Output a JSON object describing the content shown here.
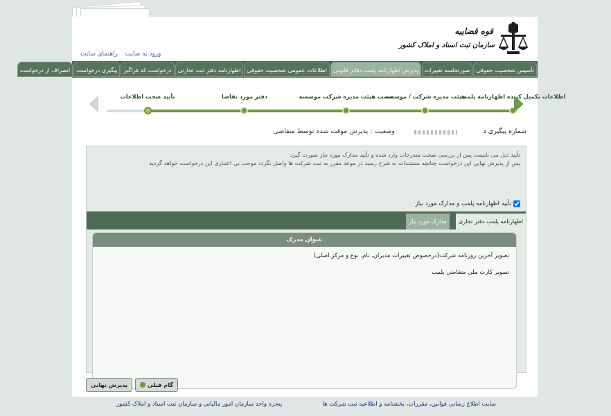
{
  "header": {
    "logo_title": "قوه قضاییه",
    "logo_subtitle": "سازمان ثبت اسناد و املاک کشور",
    "links": [
      "ورود به سایت",
      "راهنمای سایت"
    ]
  },
  "nav": {
    "tabs": [
      {
        "label": "تأسیس شخصیت حقوقی",
        "active": false
      },
      {
        "label": "صورتجلسه تغییرات",
        "active": false
      },
      {
        "label": "پذیرش اظهارنامه پلمب دفاتر قانونی",
        "active": true
      },
      {
        "label": "اطلاعات عمومی شخصیت حقوقی",
        "active": false
      },
      {
        "label": "اظهارنامه دفتر ثبت تجارتی",
        "active": false
      },
      {
        "label": "درخواست کد فراگیر",
        "active": false
      },
      {
        "label": "پیگیری درخواست",
        "active": false
      },
      {
        "label": "انصراف از درخواست",
        "active": false
      }
    ]
  },
  "steps": {
    "items": [
      {
        "label": "اطلاعات تکمیل کننده اظهارنامه پلمب",
        "pos": 97
      },
      {
        "label": "هیئت مدیره شرکت / موسسه",
        "pos": 77
      },
      {
        "label": "سمت هیئت مدیره شرکت موسسه",
        "pos": 59
      },
      {
        "label": "دفتر مورد تقاضا",
        "pos": 36
      },
      {
        "label": "تأیید صحت اطلاعات",
        "pos": 14
      }
    ]
  },
  "status": {
    "tracking_label": "شماره پیگیری د",
    "state_text": "وضعیت : پذیرش موقت شده توسط متقاضی"
  },
  "notes": [
    "تأیید ذیل می بایست پس از بررسی صحت مندرجات وارد شده و تأیید مدارک مورد نیاز صورت گیرد",
    "پس از پذیرش نهایی این درخواست چنانچه مستندات به شرح رسید در موعد مقرر به ثبت شرکت ها واصل نگردد موجب بی اعتباری این درخواست خواهد گردید"
  ],
  "confirm_label": "تأیید اظهارنامه پلمب و مدارک مورد نیاز",
  "subtabs": [
    "اظهارنامه پلمب دفتر تجاری",
    "مدارک مورد نیاز"
  ],
  "documents": {
    "header": "عنوان مدرک",
    "rows": [
      "تصویر آخرین روزنامه شرکت(درخصوص تغییرات مدیران، نام، نوع و مرکز اصلی)",
      "تصویر کارت ملی متقاضی پلمب"
    ]
  },
  "buttons": {
    "prev": "گام قبلی",
    "final": "پذیرش نهایی"
  },
  "footer": {
    "right_link": "سایت اطلاع رسانی قوانین، مقررات، بخشنامه و اطلاعیه ثبت شرکت ها",
    "left_link": "پنجره واحد سازمان امور مالیاتی و سازمان ثبت اسناد و املاک کشور"
  },
  "colors": {
    "nav_green": "#4f6b55",
    "progress_green": "#6e9b3a",
    "link_blue": "#1b2a7a"
  }
}
